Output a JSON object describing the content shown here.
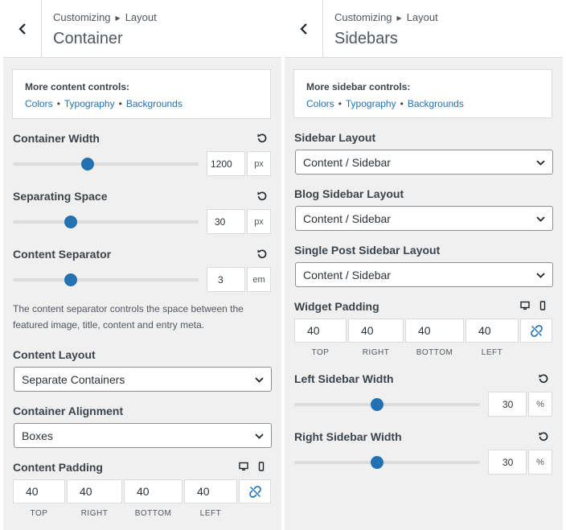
{
  "left": {
    "breadcrumb": [
      "Customizing",
      "Layout"
    ],
    "title": "Container",
    "box": {
      "title": "More content controls:",
      "links": [
        "Colors",
        "Typography",
        "Backgrounds"
      ]
    },
    "container_width": {
      "label": "Container Width",
      "value": "1200",
      "unit": "px",
      "slider": 0.39
    },
    "separating_space": {
      "label": "Separating Space",
      "value": "30",
      "unit": "px",
      "slider": 0.31
    },
    "content_separator": {
      "label": "Content Separator",
      "value": "3",
      "unit": "em",
      "slider": 0.31
    },
    "separator_desc": "The content separator controls the space between the featured image, title, content and entry meta.",
    "content_layout": {
      "label": "Content Layout",
      "value": "Separate Containers"
    },
    "container_alignment": {
      "label": "Container Alignment",
      "value": "Boxes"
    },
    "content_padding": {
      "label": "Content Padding",
      "values": [
        "40",
        "40",
        "40",
        "40"
      ],
      "sides": [
        "TOP",
        "RIGHT",
        "BOTTOM",
        "LEFT"
      ]
    }
  },
  "right": {
    "breadcrumb": [
      "Customizing",
      "Layout"
    ],
    "title": "Sidebars",
    "box": {
      "title": "More sidebar controls:",
      "links": [
        "Colors",
        "Typography",
        "Backgrounds"
      ]
    },
    "sidebar_layout": {
      "label": "Sidebar Layout",
      "value": "Content / Sidebar"
    },
    "blog_sidebar_layout": {
      "label": "Blog Sidebar Layout",
      "value": "Content / Sidebar"
    },
    "single_post_sidebar_layout": {
      "label": "Single Post Sidebar Layout",
      "value": "Content / Sidebar"
    },
    "widget_padding": {
      "label": "Widget Padding",
      "values": [
        "40",
        "40",
        "40",
        "40"
      ],
      "sides": [
        "TOP",
        "RIGHT",
        "BOTTOM",
        "LEFT"
      ]
    },
    "left_sidebar_width": {
      "label": "Left Sidebar Width",
      "value": "30",
      "unit": "%",
      "slider": 0.45
    },
    "right_sidebar_width": {
      "label": "Right Sidebar Width",
      "value": "30",
      "unit": "%",
      "slider": 0.45
    }
  },
  "colors": {
    "accent": "#2271b1",
    "panel_bg": "#f0f0f1",
    "border": "#dcdcde"
  },
  "icons": [
    "chevron-left-icon",
    "reset-icon",
    "chevron-down-icon",
    "desktop-icon",
    "mobile-icon",
    "unlink-icon"
  ]
}
